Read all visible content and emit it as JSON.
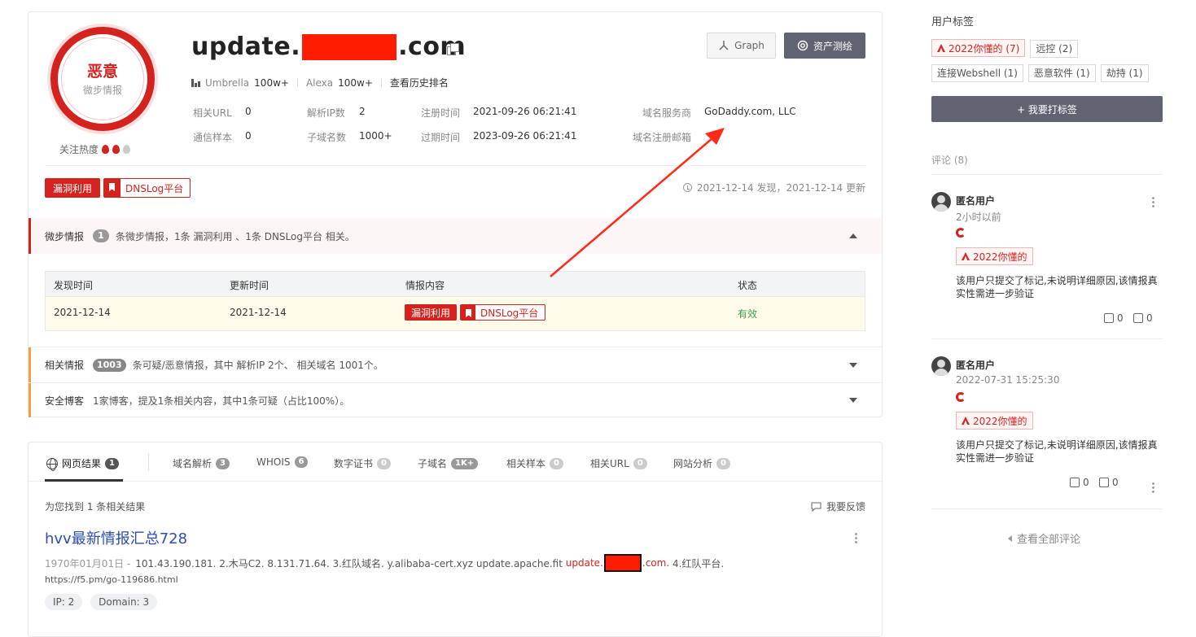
{
  "header": {
    "verdict": "恶意",
    "verdict_source": "微步情报",
    "heat_label": "关注热度",
    "domain_prefix": "update.",
    "domain_suffix": ".com",
    "umbrella_label": "Umbrella",
    "umbrella_value": "100w+",
    "alexa_label": "Alexa",
    "alexa_value": "100w+",
    "history_link": "查看历史排名",
    "graph_button": "Graph",
    "asset_button": "资产测绘"
  },
  "meta": {
    "related_url_label": "相关URL",
    "related_url_value": "0",
    "resolve_ip_label": "解析IP数",
    "resolve_ip_value": "2",
    "reg_time_label": "注册时间",
    "reg_time_value": "2021-09-26 06:21:41",
    "registrar_label": "域名服务商",
    "registrar_value": "GoDaddy.com, LLC",
    "samples_label": "通信样本",
    "samples_value": "0",
    "subdomain_label": "子域名数",
    "subdomain_value": "1000+",
    "expire_label": "过期时间",
    "expire_value": "2023-09-26 06:21:41",
    "reg_email_label": "域名注册邮箱",
    "reg_email_value": ""
  },
  "tags": {
    "exploit": "漏洞利用",
    "dnslog": "DNSLog平台",
    "found": "2021-12-14 发现，2021-12-14 更新"
  },
  "sections": {
    "weibu": {
      "name": "微步情报",
      "count": "1",
      "desc": "条微步情报，1条 漏洞利用 、1条 DNSLog平台 相关。"
    },
    "related": {
      "name": "相关情报",
      "count": "1003",
      "desc": "条可疑/恶意情报，其中 解析IP 2个、 相关域名 1001个。"
    },
    "blog": {
      "name": "安全博客",
      "desc": "1家博客，提及1条相关内容，其中1条可疑（占比100%）。"
    }
  },
  "intel_table": {
    "headers": [
      "发现时间",
      "更新时间",
      "情报内容",
      "状态"
    ],
    "row": {
      "found": "2021-12-14",
      "updated": "2021-12-14",
      "tag1": "漏洞利用",
      "tag2": "DNSLog平台",
      "status": "有效"
    }
  },
  "tabs": [
    {
      "label": "网页结果",
      "count": "1"
    },
    {
      "label": "域名解析",
      "count": "3"
    },
    {
      "label": "WHOIS",
      "count": "6"
    },
    {
      "label": "数字证书",
      "count": "0"
    },
    {
      "label": "子域名",
      "count": "1K+"
    },
    {
      "label": "相关样本",
      "count": "0"
    },
    {
      "label": "相关URL",
      "count": "0"
    },
    {
      "label": "网站分析",
      "count": "0"
    }
  ],
  "results": {
    "summary": "为您找到 1 条相关结果",
    "feedback": "我要反馈",
    "title": "hvv最新情报汇总728",
    "date": "1970年01月01日 -",
    "snippet_pre": "101.43.190.181. 2.木马C2. 8.131.71.64. 3.红队域名. y.alibaba-cert.xyz update.apache.fit",
    "snippet_hl_pre": "update.",
    "snippet_hl_post": ".com.",
    "snippet_post": "4.红队平台.",
    "url": "https://f5.pm/go-119686.html",
    "chip_ip": "IP: 2",
    "chip_domain": "Domain: 3"
  },
  "sidebar": {
    "user_tags_title": "用户标签",
    "tags": [
      "2022你懂的 (7)",
      "远控 (2)",
      "连接Webshell (1)",
      "恶意软件 (1)",
      "劫持 (1)"
    ],
    "add_tag_button": "+ 我要打标签",
    "comments_title": "评论 (8)",
    "comments": [
      {
        "user": "匿名用户",
        "time": "2小时以前",
        "tag": "2022你懂的",
        "text": "该用户只提交了标记,未说明详细原因,该情报真实性需进一步验证",
        "up": "0",
        "down": "0"
      },
      {
        "user": "匿名用户",
        "time": "2022-07-31 15:25:30",
        "tag": "2022你懂的",
        "text": "该用户只提交了标记,未说明详细原因,该情报真实性需进一步验证",
        "up": "0",
        "down": "0"
      }
    ],
    "view_all": "查看全部评论"
  },
  "colors": {
    "malicious": "#d4231f",
    "valid": "#3aa14a",
    "link": "#2b4db3",
    "annotation_arrow": "#ff2a1a"
  }
}
